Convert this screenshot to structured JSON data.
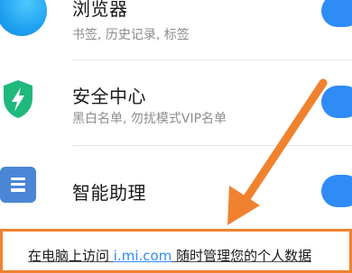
{
  "rows": [
    {
      "title": "浏览器",
      "subtitle": "书签, 历史记录, 标签",
      "icon": "browser-icon",
      "toggle_on": true
    },
    {
      "title": "安全中心",
      "subtitle": "黑白名单, 勿扰模式VIP名单",
      "icon": "security-shield-icon",
      "toggle_on": true
    },
    {
      "title": "智能助理",
      "subtitle": "",
      "icon": "assistant-icon",
      "toggle_on": true
    }
  ],
  "banner": {
    "prefix": "在电脑上访问 ",
    "link": "i.mi.com",
    "suffix": " 随时管理您的个人数据"
  },
  "colors": {
    "accent_blue": "#2f8bf5",
    "shield_green": "#1fb87d",
    "assistant_blue": "#4b86d6",
    "annotation_orange": "#f0812f"
  }
}
